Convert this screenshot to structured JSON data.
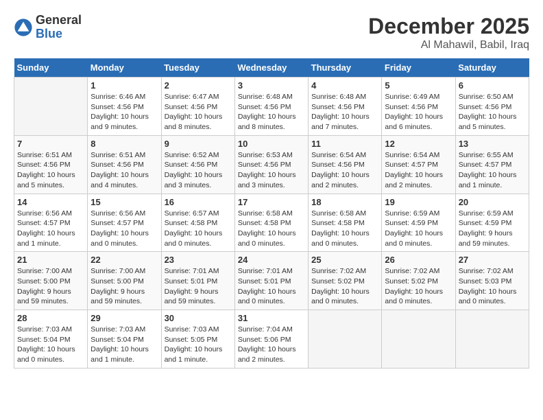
{
  "header": {
    "logo_general": "General",
    "logo_blue": "Blue",
    "month_title": "December 2025",
    "location": "Al Mahawil, Babil, Iraq"
  },
  "days_of_week": [
    "Sunday",
    "Monday",
    "Tuesday",
    "Wednesday",
    "Thursday",
    "Friday",
    "Saturday"
  ],
  "weeks": [
    [
      {
        "day": "",
        "sunrise": "",
        "sunset": "",
        "daylight": ""
      },
      {
        "day": "1",
        "sunrise": "6:46 AM",
        "sunset": "4:56 PM",
        "daylight": "10 hours and 9 minutes."
      },
      {
        "day": "2",
        "sunrise": "6:47 AM",
        "sunset": "4:56 PM",
        "daylight": "10 hours and 8 minutes."
      },
      {
        "day": "3",
        "sunrise": "6:48 AM",
        "sunset": "4:56 PM",
        "daylight": "10 hours and 8 minutes."
      },
      {
        "day": "4",
        "sunrise": "6:48 AM",
        "sunset": "4:56 PM",
        "daylight": "10 hours and 7 minutes."
      },
      {
        "day": "5",
        "sunrise": "6:49 AM",
        "sunset": "4:56 PM",
        "daylight": "10 hours and 6 minutes."
      },
      {
        "day": "6",
        "sunrise": "6:50 AM",
        "sunset": "4:56 PM",
        "daylight": "10 hours and 5 minutes."
      }
    ],
    [
      {
        "day": "7",
        "sunrise": "6:51 AM",
        "sunset": "4:56 PM",
        "daylight": "10 hours and 5 minutes."
      },
      {
        "day": "8",
        "sunrise": "6:51 AM",
        "sunset": "4:56 PM",
        "daylight": "10 hours and 4 minutes."
      },
      {
        "day": "9",
        "sunrise": "6:52 AM",
        "sunset": "4:56 PM",
        "daylight": "10 hours and 3 minutes."
      },
      {
        "day": "10",
        "sunrise": "6:53 AM",
        "sunset": "4:56 PM",
        "daylight": "10 hours and 3 minutes."
      },
      {
        "day": "11",
        "sunrise": "6:54 AM",
        "sunset": "4:56 PM",
        "daylight": "10 hours and 2 minutes."
      },
      {
        "day": "12",
        "sunrise": "6:54 AM",
        "sunset": "4:57 PM",
        "daylight": "10 hours and 2 minutes."
      },
      {
        "day": "13",
        "sunrise": "6:55 AM",
        "sunset": "4:57 PM",
        "daylight": "10 hours and 1 minute."
      }
    ],
    [
      {
        "day": "14",
        "sunrise": "6:56 AM",
        "sunset": "4:57 PM",
        "daylight": "10 hours and 1 minute."
      },
      {
        "day": "15",
        "sunrise": "6:56 AM",
        "sunset": "4:57 PM",
        "daylight": "10 hours and 0 minutes."
      },
      {
        "day": "16",
        "sunrise": "6:57 AM",
        "sunset": "4:58 PM",
        "daylight": "10 hours and 0 minutes."
      },
      {
        "day": "17",
        "sunrise": "6:58 AM",
        "sunset": "4:58 PM",
        "daylight": "10 hours and 0 minutes."
      },
      {
        "day": "18",
        "sunrise": "6:58 AM",
        "sunset": "4:58 PM",
        "daylight": "10 hours and 0 minutes."
      },
      {
        "day": "19",
        "sunrise": "6:59 AM",
        "sunset": "4:59 PM",
        "daylight": "10 hours and 0 minutes."
      },
      {
        "day": "20",
        "sunrise": "6:59 AM",
        "sunset": "4:59 PM",
        "daylight": "9 hours and 59 minutes."
      }
    ],
    [
      {
        "day": "21",
        "sunrise": "7:00 AM",
        "sunset": "5:00 PM",
        "daylight": "9 hours and 59 minutes."
      },
      {
        "day": "22",
        "sunrise": "7:00 AM",
        "sunset": "5:00 PM",
        "daylight": "9 hours and 59 minutes."
      },
      {
        "day": "23",
        "sunrise": "7:01 AM",
        "sunset": "5:01 PM",
        "daylight": "9 hours and 59 minutes."
      },
      {
        "day": "24",
        "sunrise": "7:01 AM",
        "sunset": "5:01 PM",
        "daylight": "10 hours and 0 minutes."
      },
      {
        "day": "25",
        "sunrise": "7:02 AM",
        "sunset": "5:02 PM",
        "daylight": "10 hours and 0 minutes."
      },
      {
        "day": "26",
        "sunrise": "7:02 AM",
        "sunset": "5:02 PM",
        "daylight": "10 hours and 0 minutes."
      },
      {
        "day": "27",
        "sunrise": "7:02 AM",
        "sunset": "5:03 PM",
        "daylight": "10 hours and 0 minutes."
      }
    ],
    [
      {
        "day": "28",
        "sunrise": "7:03 AM",
        "sunset": "5:04 PM",
        "daylight": "10 hours and 0 minutes."
      },
      {
        "day": "29",
        "sunrise": "7:03 AM",
        "sunset": "5:04 PM",
        "daylight": "10 hours and 1 minute."
      },
      {
        "day": "30",
        "sunrise": "7:03 AM",
        "sunset": "5:05 PM",
        "daylight": "10 hours and 1 minute."
      },
      {
        "day": "31",
        "sunrise": "7:04 AM",
        "sunset": "5:06 PM",
        "daylight": "10 hours and 2 minutes."
      },
      {
        "day": "",
        "sunrise": "",
        "sunset": "",
        "daylight": ""
      },
      {
        "day": "",
        "sunrise": "",
        "sunset": "",
        "daylight": ""
      },
      {
        "day": "",
        "sunrise": "",
        "sunset": "",
        "daylight": ""
      }
    ]
  ],
  "labels": {
    "sunrise_prefix": "Sunrise: ",
    "sunset_prefix": "Sunset: ",
    "daylight_prefix": "Daylight: "
  }
}
